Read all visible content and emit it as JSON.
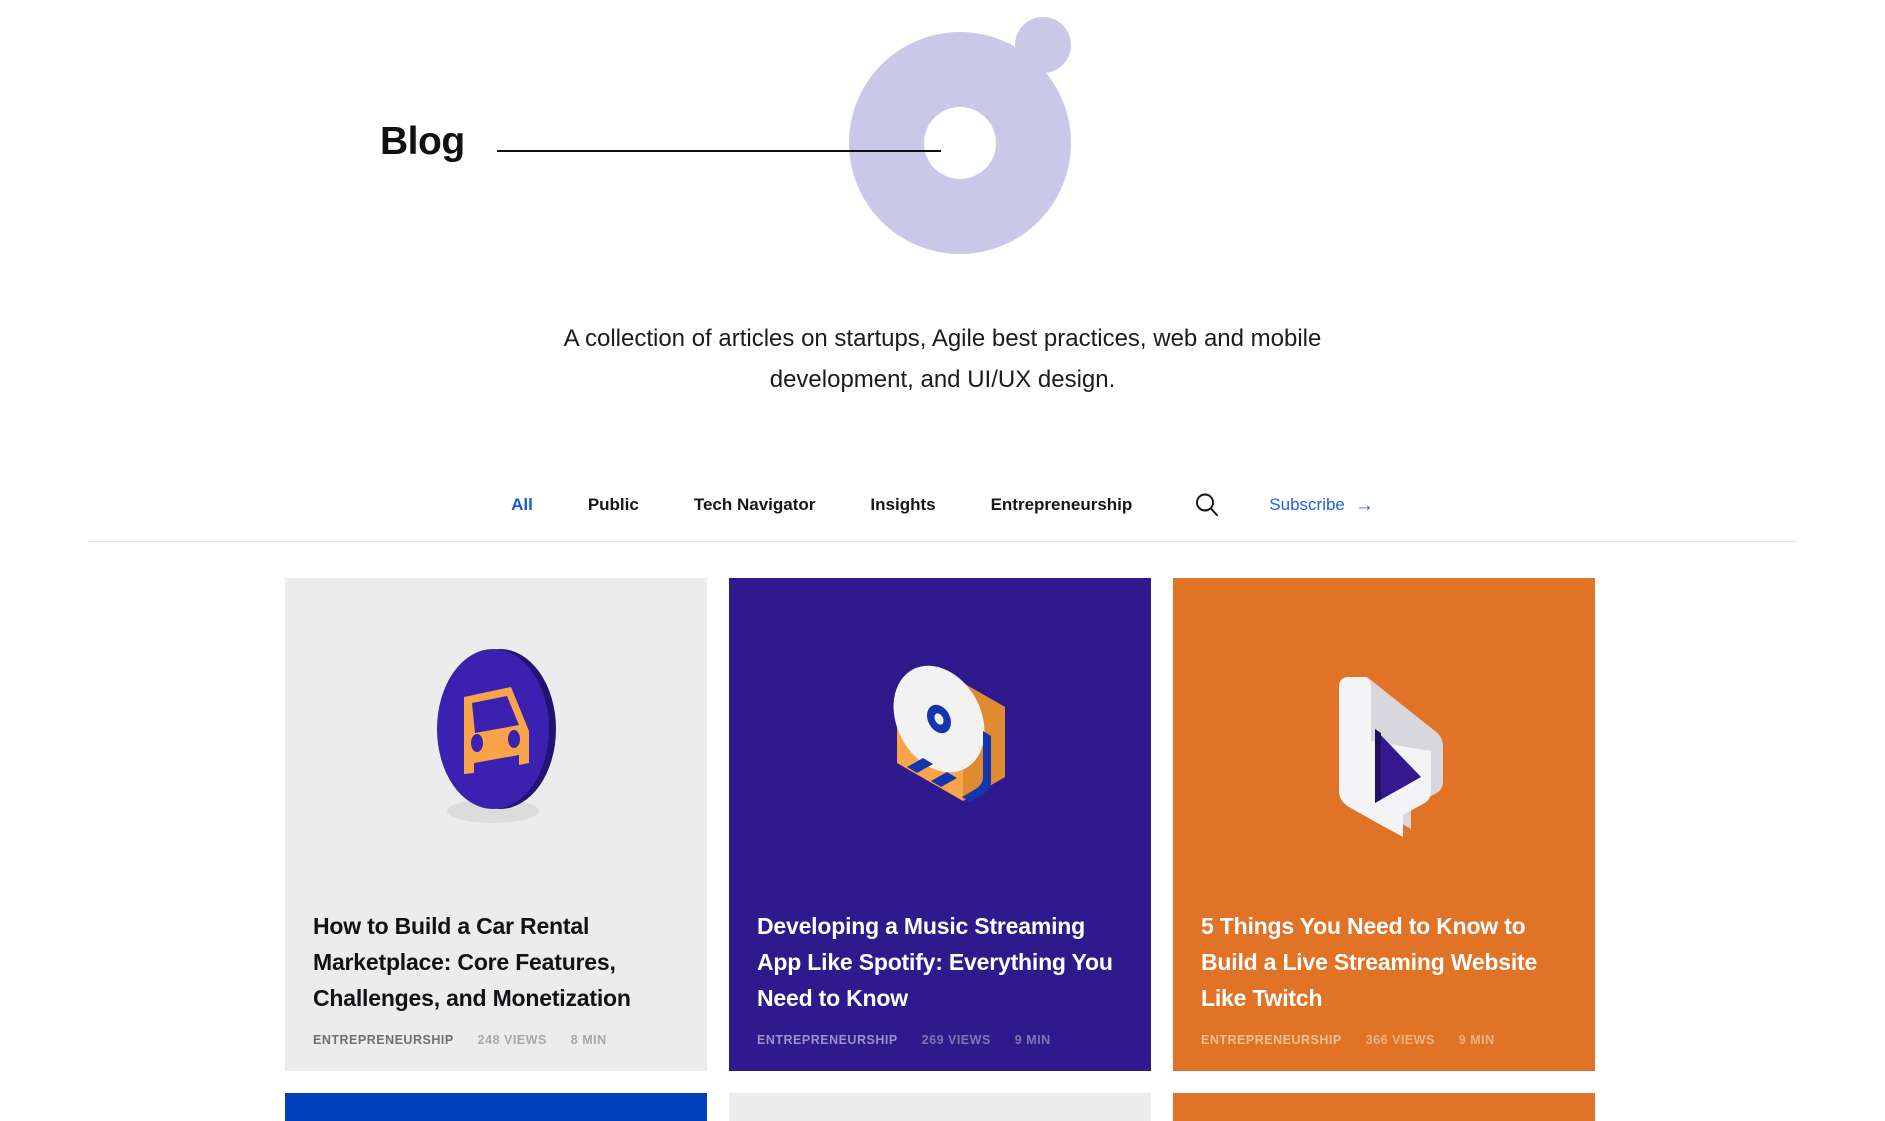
{
  "hero": {
    "title": "Blog",
    "subtitle_line1": "A collection of articles on startups, Agile best practices, web and mobile",
    "subtitle_line2": "development, and UI/UX design.",
    "decor": {
      "donut_color": "#c9c8e8",
      "dot_color": "#c9c8e8",
      "rule_color": "#101013"
    }
  },
  "filters": {
    "items": [
      {
        "label": "All",
        "active": true
      },
      {
        "label": "Public",
        "active": false
      },
      {
        "label": "Tech Navigator",
        "active": false
      },
      {
        "label": "Insights",
        "active": false
      },
      {
        "label": "Entrepreneurship",
        "active": false
      }
    ],
    "active_color": "#1557d6",
    "search_icon": "search-icon",
    "subscribe_label": "Subscribe",
    "subscribe_arrow": "→",
    "subscribe_color": "#1f62e0"
  },
  "cards": [
    {
      "theme": "light",
      "bg": "#ececec",
      "art": "car-disc-illustration",
      "title": "How to Build a Car Rental Marketplace: Core Features, Challenges, and Monetization",
      "category": "ENTREPRENEURSHIP",
      "views": "248 VIEWS",
      "read_time": "8 MIN"
    },
    {
      "theme": "purple",
      "bg": "#2e1a8c",
      "art": "music-player-illustration",
      "title": "Developing a Music Streaming App Like Spotify: Everything You Need to Know",
      "category": "ENTREPRENEURSHIP",
      "views": "269 VIEWS",
      "read_time": "9 MIN"
    },
    {
      "theme": "orange",
      "bg": "#e07325",
      "art": "chat-play-illustration",
      "title": "5 Things You Need to Know to Build a Live Streaming Website Like Twitch",
      "category": "ENTREPRENEURSHIP",
      "views": "366 VIEWS",
      "read_time": "9 MIN"
    }
  ],
  "cards_row2": [
    {
      "theme": "blue",
      "bg": "#0040bb"
    },
    {
      "theme": "light",
      "bg": "#ececec"
    },
    {
      "theme": "orange",
      "bg": "#e07325"
    }
  ]
}
